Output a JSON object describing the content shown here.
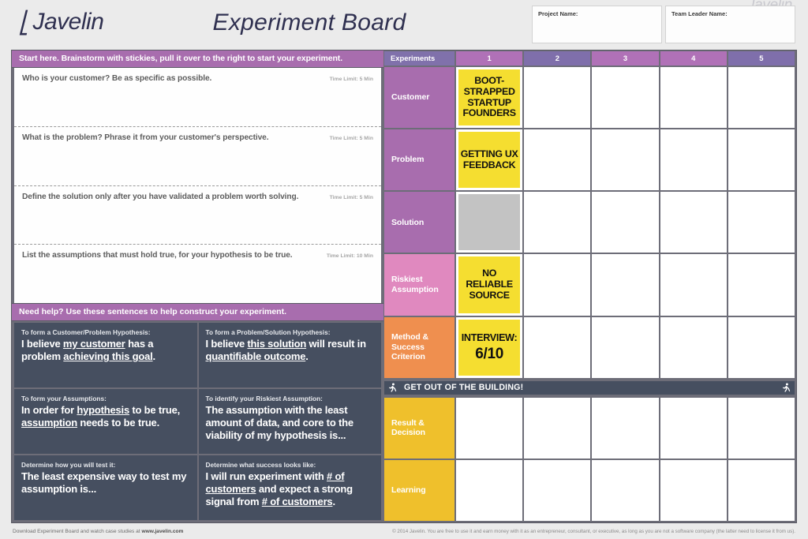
{
  "header": {
    "logo_text": "Javelin",
    "logo_icon": "lightning-bolt-icon",
    "title": "Experiment Board",
    "watermark": "Javelin",
    "project_name_label": "Project Name:",
    "project_name_value": "",
    "team_leader_label": "Team Leader Name:",
    "team_leader_value": ""
  },
  "left_panel": {
    "top_banner": "Start here. Brainstorm with stickies, pull it over to the right to start your experiment.",
    "brainstorm": [
      {
        "prompt": "Who is your customer? Be as specific as possible.",
        "time_limit": "Time Limit: 5 Min"
      },
      {
        "prompt": "What is the problem? Phrase it from your customer's perspective.",
        "time_limit": "Time Limit: 5 Min"
      },
      {
        "prompt": "Define the solution only after you have validated a problem worth solving.",
        "time_limit": "Time Limit: 5 Min"
      },
      {
        "prompt": "List the assumptions that must hold true, for your hypothesis to be true.",
        "time_limit": "Time Limit: 10 Min"
      }
    ],
    "helper_banner": "Need help? Use these sentences to help construct your experiment.",
    "helpers": [
      {
        "kicker": "To form a Customer/Problem Hypothesis:",
        "parts": [
          {
            "text": "I believe ",
            "underline": false
          },
          {
            "text": "my customer",
            "underline": true
          },
          {
            "text": " has a problem ",
            "underline": false
          },
          {
            "text": "achieving this goal",
            "underline": true
          },
          {
            "text": ".",
            "underline": false
          }
        ]
      },
      {
        "kicker": "To form a Problem/Solution Hypothesis:",
        "parts": [
          {
            "text": "I believe ",
            "underline": false
          },
          {
            "text": "this solution",
            "underline": true
          },
          {
            "text": " will result in ",
            "underline": false
          },
          {
            "text": "quantifiable outcome",
            "underline": true
          },
          {
            "text": ".",
            "underline": false
          }
        ]
      },
      {
        "kicker": "To form your Assumptions:",
        "parts": [
          {
            "text": "In order for ",
            "underline": false
          },
          {
            "text": "hypothesis",
            "underline": true
          },
          {
            "text": " to be true, ",
            "underline": false
          },
          {
            "text": "assumption",
            "underline": true
          },
          {
            "text": " needs to be true.",
            "underline": false
          }
        ]
      },
      {
        "kicker": "To identify your Riskiest Assumption:",
        "parts": [
          {
            "text": "The assumption with the least amount of data, and core to the viability of my hypothesis is...",
            "underline": false
          }
        ]
      },
      {
        "kicker": "Determine how you will test it:",
        "parts": [
          {
            "text": "The least expensive way to test my assumption is...",
            "underline": false
          }
        ]
      },
      {
        "kicker": "Determine what success looks like:",
        "parts": [
          {
            "text": "I will run experiment with ",
            "underline": false
          },
          {
            "text": "# of customers",
            "underline": true
          },
          {
            "text": " and expect a strong signal from ",
            "underline": false
          },
          {
            "text": "# of customers",
            "underline": true
          },
          {
            "text": ".",
            "underline": false
          }
        ]
      }
    ]
  },
  "grid": {
    "corner_label": "Experiments",
    "columns": [
      "1",
      "2",
      "3",
      "4",
      "5"
    ],
    "column_colors": [
      "#b071b7",
      "#7f6fab",
      "#b071b7",
      "#b071b7",
      "#7f6fab"
    ],
    "corner_color": "#8071ab",
    "rows": [
      {
        "label": "Customer",
        "color": "#a86dae",
        "cells": [
          {
            "text": "BOOT-STRAPPED STARTUP FOUNDERS",
            "style": "yellow"
          },
          {
            "text": "",
            "style": "empty"
          },
          {
            "text": "",
            "style": "empty"
          },
          {
            "text": "",
            "style": "empty"
          },
          {
            "text": "",
            "style": "empty"
          }
        ]
      },
      {
        "label": "Problem",
        "color": "#a86dae",
        "cells": [
          {
            "text": "GETTING UX FEEDBACK",
            "style": "yellow"
          },
          {
            "text": "",
            "style": "empty"
          },
          {
            "text": "",
            "style": "empty"
          },
          {
            "text": "",
            "style": "empty"
          },
          {
            "text": "",
            "style": "empty"
          }
        ]
      },
      {
        "label": "Solution",
        "color": "#a86dae",
        "cells": [
          {
            "text": "",
            "style": "gray"
          },
          {
            "text": "",
            "style": "empty"
          },
          {
            "text": "",
            "style": "empty"
          },
          {
            "text": "",
            "style": "empty"
          },
          {
            "text": "",
            "style": "empty"
          }
        ]
      },
      {
        "label": "Riskiest Assumption",
        "color": "#e089bf",
        "cells": [
          {
            "text": "NO RELIABLE SOURCE",
            "style": "yellow"
          },
          {
            "text": "",
            "style": "empty"
          },
          {
            "text": "",
            "style": "empty"
          },
          {
            "text": "",
            "style": "empty"
          },
          {
            "text": "",
            "style": "empty"
          }
        ]
      },
      {
        "label": "Method & Success Criterion",
        "color": "#ef8f4f",
        "cells": [
          {
            "text": "INTERVIEW:",
            "big": "6/10",
            "style": "yellow"
          },
          {
            "text": "",
            "style": "empty"
          },
          {
            "text": "",
            "style": "empty"
          },
          {
            "text": "",
            "style": "empty"
          },
          {
            "text": "",
            "style": "empty"
          }
        ]
      },
      {
        "label": "Result & Decision",
        "color": "#efc02c",
        "cells": [
          {
            "text": "",
            "style": "empty"
          },
          {
            "text": "",
            "style": "empty"
          },
          {
            "text": "",
            "style": "empty"
          },
          {
            "text": "",
            "style": "empty"
          },
          {
            "text": "",
            "style": "empty"
          }
        ]
      },
      {
        "label": "Learning",
        "color": "#efc02c",
        "cells": [
          {
            "text": "",
            "style": "empty"
          },
          {
            "text": "",
            "style": "empty"
          },
          {
            "text": "",
            "style": "empty"
          },
          {
            "text": "",
            "style": "empty"
          },
          {
            "text": "",
            "style": "empty"
          }
        ]
      }
    ],
    "get_out_banner": "GET OUT OF THE BUILDING!",
    "runner_icon": "running-person-icon"
  },
  "footer": {
    "left_prefix": "Download Experiment Board and watch case studies at ",
    "left_url": "www.javelin.com",
    "right": "© 2014 Javelin. You are free to use it and earn money with it as an entrepreneur, consultant, or executive, as long as you are not a software company (the latter need to license it from us)."
  }
}
